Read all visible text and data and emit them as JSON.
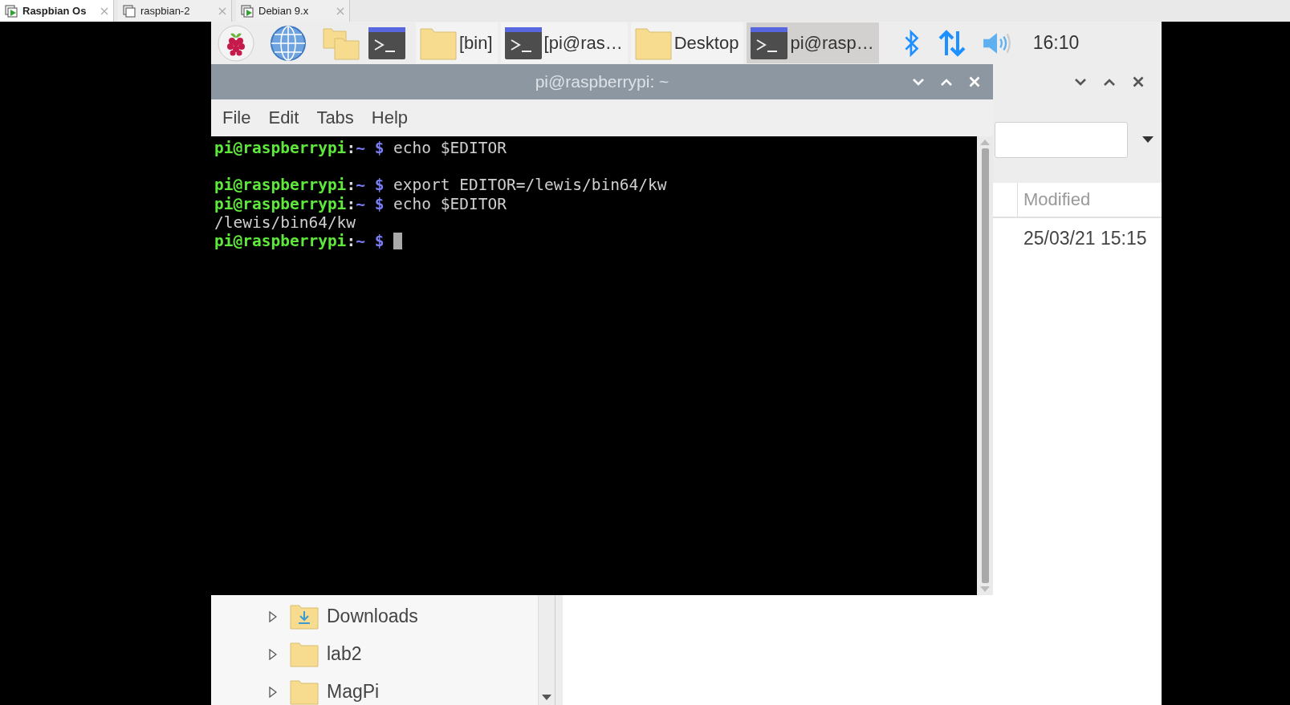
{
  "vm_tabs": [
    {
      "label": "Raspbian Os",
      "selected": true,
      "running": true
    },
    {
      "label": "raspbian-2",
      "selected": false,
      "running": false
    },
    {
      "label": "Debian 9.x",
      "selected": false,
      "running": true
    }
  ],
  "taskbar": {
    "windows": [
      {
        "kind": "folder",
        "label": "[bin]",
        "selected": false
      },
      {
        "kind": "terminal",
        "label": "[pi@ras…",
        "selected": false
      },
      {
        "kind": "folder",
        "label": "Desktop",
        "selected": false
      },
      {
        "kind": "terminal",
        "label": "pi@rasp…",
        "selected": true
      }
    ],
    "clock": "16:10"
  },
  "file_manager": {
    "columns": [
      "Modified"
    ],
    "rows": [
      {
        "modified": "25/03/21 15:15"
      }
    ],
    "tree": [
      {
        "kind": "downloads",
        "label": "Downloads",
        "expanded": false
      },
      {
        "kind": "folder",
        "label": "lab2",
        "expanded": false
      },
      {
        "kind": "folder",
        "label": "MagPi",
        "expanded": false
      }
    ]
  },
  "terminal": {
    "title": "pi@raspberrypi: ~",
    "menu": [
      "File",
      "Edit",
      "Tabs",
      "Help"
    ],
    "lines": [
      {
        "kind": "prompt",
        "user": "pi@raspberrypi",
        "separator": ":",
        "dir": "~",
        "symbol": "$",
        "command": "echo $EDITOR",
        "cursor": false
      },
      {
        "kind": "blank"
      },
      {
        "kind": "prompt",
        "user": "pi@raspberrypi",
        "separator": ":",
        "dir": "~",
        "symbol": "$",
        "command": "export EDITOR=/lewis/bin64/kw",
        "cursor": false
      },
      {
        "kind": "prompt",
        "user": "pi@raspberrypi",
        "separator": ":",
        "dir": "~",
        "symbol": "$",
        "command": "echo $EDITOR",
        "cursor": false
      },
      {
        "kind": "output",
        "text": "/lewis/bin64/kw"
      },
      {
        "kind": "prompt",
        "user": "pi@raspberrypi",
        "separator": ":",
        "dir": "~",
        "symbol": "$",
        "cursor": true
      }
    ]
  }
}
